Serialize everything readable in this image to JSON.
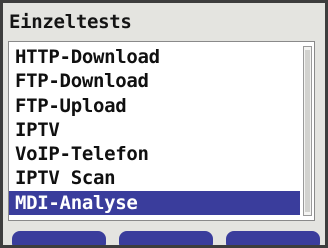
{
  "header": {
    "title": "Einzeltests"
  },
  "list": {
    "items": [
      {
        "label": "HTTP-Download"
      },
      {
        "label": "FTP-Download"
      },
      {
        "label": "FTP-Upload"
      },
      {
        "label": "IPTV"
      },
      {
        "label": "VoIP-Telefon"
      },
      {
        "label": "IPTV Scan"
      },
      {
        "label": "MDI-Analyse"
      }
    ],
    "selected_index": 6
  },
  "colors": {
    "highlight": "#3a3d9c",
    "background": "#e4e4e0",
    "bezel": "#3d3d3d"
  }
}
